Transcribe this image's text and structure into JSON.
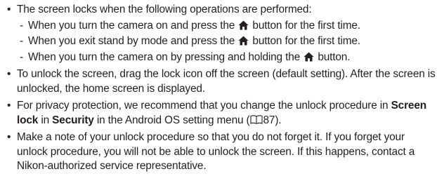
{
  "bullet_char": "•",
  "dash_char": "-",
  "icons": {
    "home_button": "home-icon",
    "page_reference": "book-icon"
  },
  "items": [
    {
      "text": "The screen locks when the following operations are performed:",
      "sub": [
        {
          "before": "When you turn the camera on and press the",
          "after": "button for the first time."
        },
        {
          "before": "When you exit stand by mode and press the",
          "after": "button for the first time."
        },
        {
          "before": "When you turn the camera on by pressing and holding the",
          "after": "button."
        }
      ]
    },
    {
      "text": "To unlock the screen, drag the lock icon off the screen (default setting). After the screen is unlocked, the home screen is displayed."
    },
    {
      "pre": "For privacy protection, we recommend that you change the unlock procedure in",
      "bold1": "Screen lock",
      "mid": "in",
      "bold2": "Security",
      "post": "in the Android OS setting menu (",
      "page_ref": "87",
      "close": ")."
    },
    {
      "text": "Make a note of your unlock procedure so that you do not forget it. If you forget your unlock procedure, you will not be able to unlock the screen. If this happens, contact a Nikon-authorized service representative."
    }
  ]
}
